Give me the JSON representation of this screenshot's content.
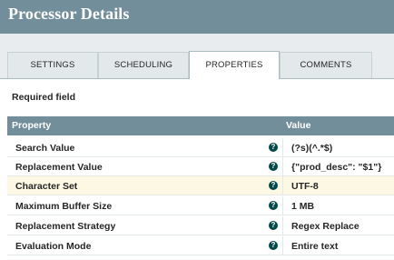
{
  "dialog": {
    "title": "Processor Details"
  },
  "tabs": [
    {
      "label": "SETTINGS",
      "active": false
    },
    {
      "label": "SCHEDULING",
      "active": false
    },
    {
      "label": "PROPERTIES",
      "active": true
    },
    {
      "label": "COMMENTS",
      "active": false
    }
  ],
  "required_label": "Required field",
  "table": {
    "columns": {
      "property": "Property",
      "value": "Value"
    },
    "help_icon": "?",
    "rows": [
      {
        "name": "Search Value",
        "value": "(?s)(^.*$)"
      },
      {
        "name": "Replacement Value",
        "value": "{\"prod_desc\": \"$1\"}"
      },
      {
        "name": "Character Set",
        "value": "UTF-8",
        "highlighted": true
      },
      {
        "name": "Maximum Buffer Size",
        "value": "1 MB"
      },
      {
        "name": "Replacement Strategy",
        "value": "Regex Replace"
      },
      {
        "name": "Evaluation Mode",
        "value": "Entire text"
      }
    ]
  },
  "colors": {
    "header": "#728e9b",
    "tab_bg": "#e3e8eb",
    "help_icon": "#004849",
    "highlight_row": "#fcf8e3"
  }
}
